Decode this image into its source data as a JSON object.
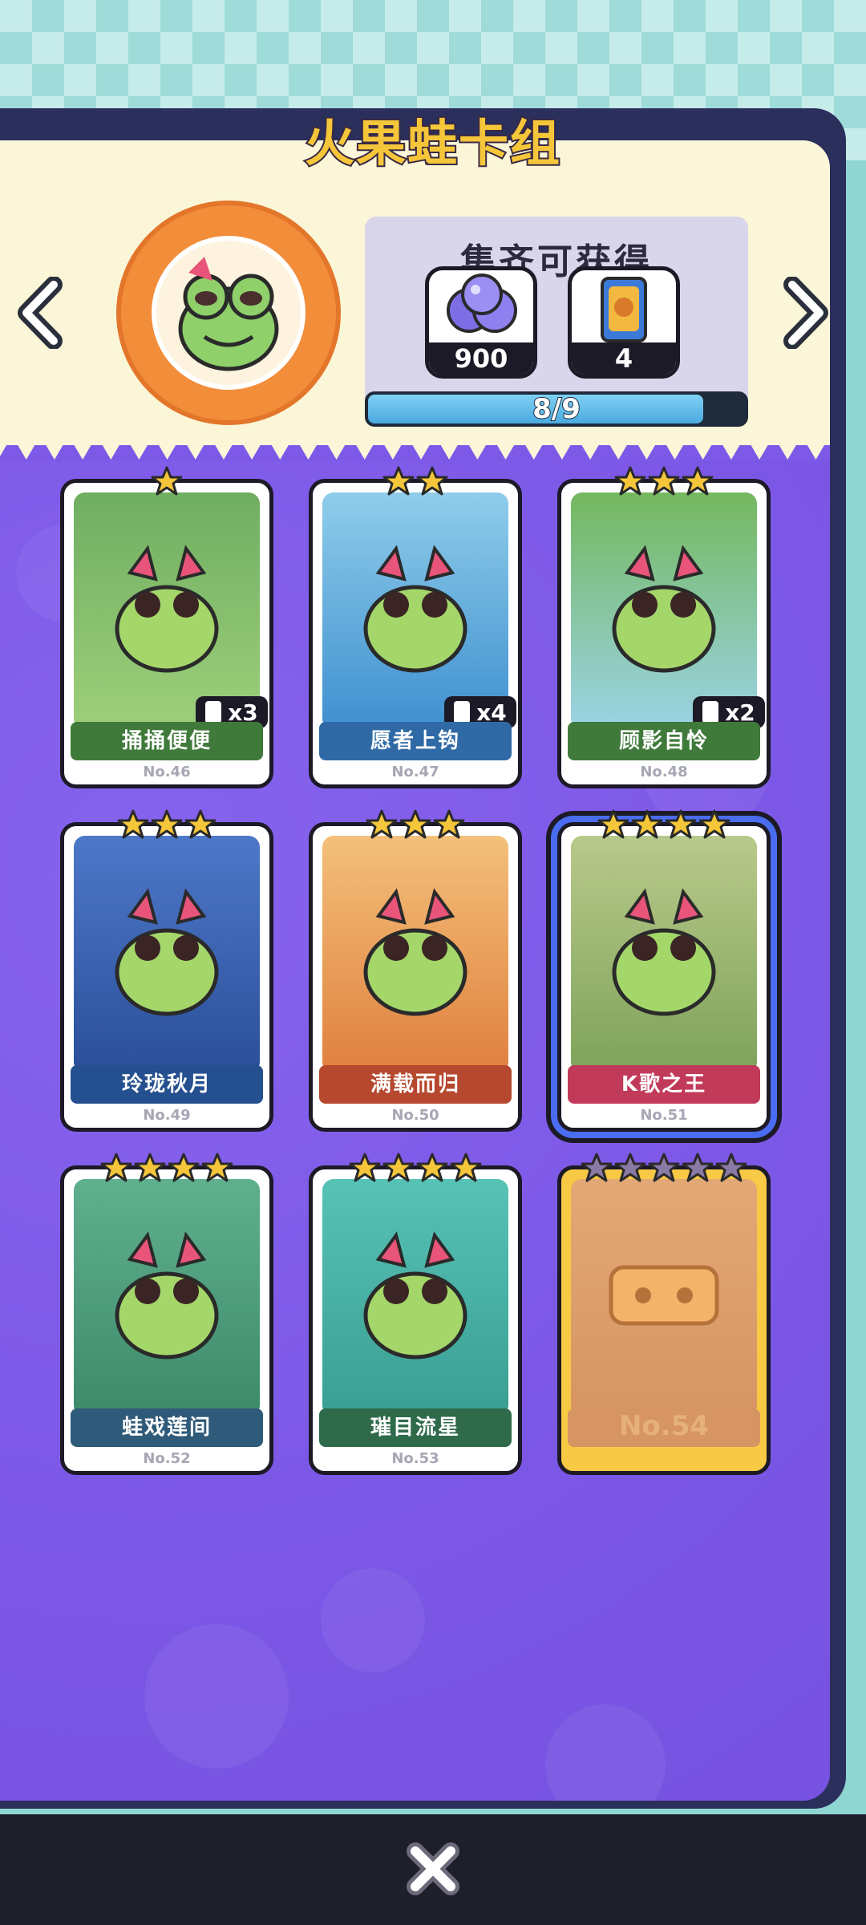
{
  "title": "火果蛙卡组",
  "reward": {
    "heading": "集齐可获得",
    "items": [
      {
        "icon": "orb-cluster-icon",
        "count": "900"
      },
      {
        "icon": "card-pack-icon",
        "count": "4"
      }
    ],
    "progress_text": "8/9",
    "progress_value": 0.8889
  },
  "cards": [
    {
      "name": "捅捅便便",
      "no": "No.46",
      "stars": 1,
      "dup": "x3",
      "theme": "#3f7a3a",
      "art": [
        "#6fae62",
        "#9ecf7a"
      ]
    },
    {
      "name": "愿者上钩",
      "no": "No.47",
      "stars": 2,
      "dup": "x4",
      "theme": "#2f6aa6",
      "art": [
        "#8fcdea",
        "#3f8fd0"
      ]
    },
    {
      "name": "顾影自怜",
      "no": "No.48",
      "stars": 3,
      "dup": "x2",
      "theme": "#3f7a3a",
      "art": [
        "#74b85e",
        "#9bd3e6"
      ]
    },
    {
      "name": "玲珑秋月",
      "no": "No.49",
      "stars": 3,
      "dup": "",
      "theme": "#24508f",
      "art": [
        "#4d78c8",
        "#2b4f9a"
      ]
    },
    {
      "name": "满载而归",
      "no": "No.50",
      "stars": 3,
      "dup": "",
      "theme": "#b5482e",
      "art": [
        "#f3c07a",
        "#e0803f"
      ]
    },
    {
      "name": "K歌之王",
      "no": "No.51",
      "stars": 4,
      "dup": "",
      "theme": "#c23a59",
      "art": [
        "#b9c98b",
        "#7ea35a"
      ]
    },
    {
      "name": "蛙戏莲间",
      "no": "No.52",
      "stars": 4,
      "dup": "",
      "theme": "#2f5a7a",
      "art": [
        "#5fb08e",
        "#3d8a6a"
      ]
    },
    {
      "name": "璀目流星",
      "no": "No.53",
      "stars": 4,
      "dup": "",
      "theme": "#2f6a4a",
      "art": [
        "#57c2b6",
        "#3a9e93"
      ]
    },
    {
      "name": "",
      "no": "No.54",
      "stars": 5,
      "dup": "",
      "theme": "#c98a54",
      "art": [
        "#e2a876",
        "#d69563"
      ],
      "locked": true
    }
  ],
  "close_icon": "close-icon"
}
